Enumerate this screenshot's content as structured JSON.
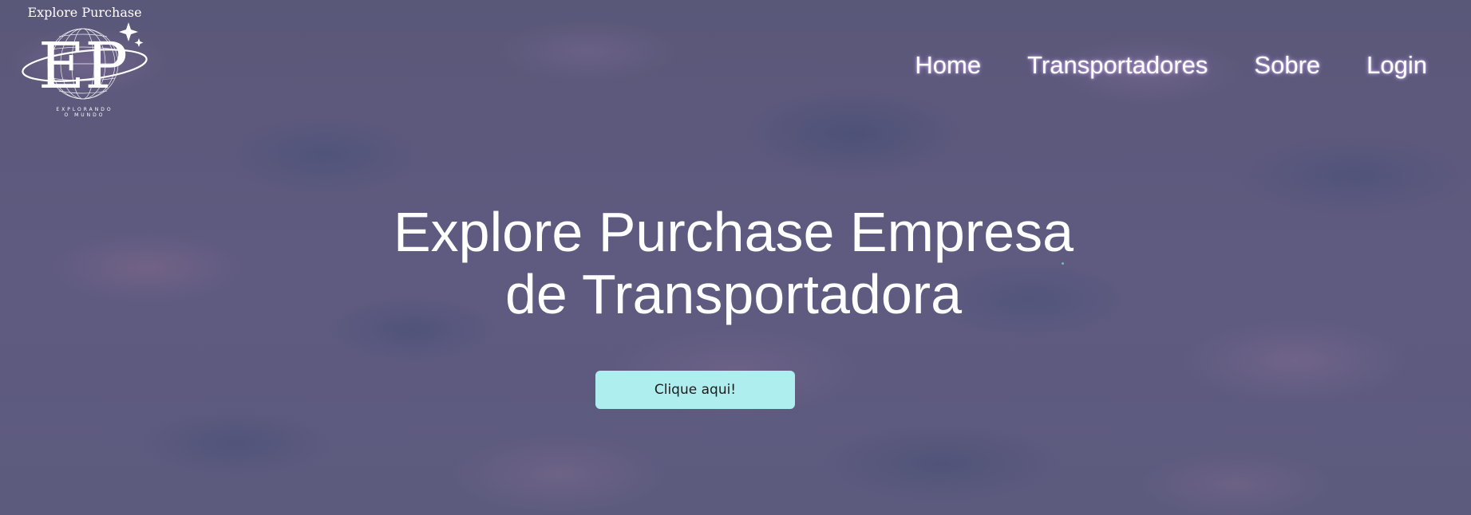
{
  "brand": {
    "title": "Explore Purchase",
    "monogram": "EP",
    "tagline_line1": "EXPLORANDO",
    "tagline_line2": "O MUNDO"
  },
  "nav": {
    "items": [
      {
        "label": "Home"
      },
      {
        "label": "Transportadores"
      },
      {
        "label": "Sobre"
      },
      {
        "label": "Login"
      }
    ]
  },
  "hero": {
    "title_line1": "Explore Purchase Empresa",
    "title_line2": "de Transportadora",
    "cta_label": "Clique aqui!"
  },
  "colors": {
    "background": "#5b5a7c",
    "button": "#aeeeee",
    "text": "#ffffff"
  }
}
